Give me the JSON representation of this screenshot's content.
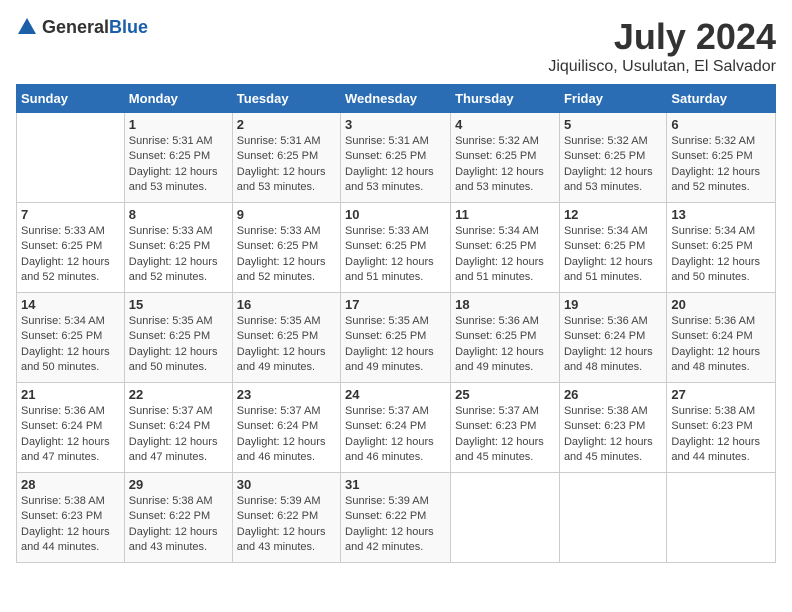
{
  "header": {
    "logo_general": "General",
    "logo_blue": "Blue",
    "title": "July 2024",
    "location": "Jiquilisco, Usulutan, El Salvador"
  },
  "weekdays": [
    "Sunday",
    "Monday",
    "Tuesday",
    "Wednesday",
    "Thursday",
    "Friday",
    "Saturday"
  ],
  "weeks": [
    [
      {
        "day": "",
        "info": ""
      },
      {
        "day": "1",
        "info": "Sunrise: 5:31 AM\nSunset: 6:25 PM\nDaylight: 12 hours\nand 53 minutes."
      },
      {
        "day": "2",
        "info": "Sunrise: 5:31 AM\nSunset: 6:25 PM\nDaylight: 12 hours\nand 53 minutes."
      },
      {
        "day": "3",
        "info": "Sunrise: 5:31 AM\nSunset: 6:25 PM\nDaylight: 12 hours\nand 53 minutes."
      },
      {
        "day": "4",
        "info": "Sunrise: 5:32 AM\nSunset: 6:25 PM\nDaylight: 12 hours\nand 53 minutes."
      },
      {
        "day": "5",
        "info": "Sunrise: 5:32 AM\nSunset: 6:25 PM\nDaylight: 12 hours\nand 53 minutes."
      },
      {
        "day": "6",
        "info": "Sunrise: 5:32 AM\nSunset: 6:25 PM\nDaylight: 12 hours\nand 52 minutes."
      }
    ],
    [
      {
        "day": "7",
        "info": "Sunrise: 5:33 AM\nSunset: 6:25 PM\nDaylight: 12 hours\nand 52 minutes."
      },
      {
        "day": "8",
        "info": "Sunrise: 5:33 AM\nSunset: 6:25 PM\nDaylight: 12 hours\nand 52 minutes."
      },
      {
        "day": "9",
        "info": "Sunrise: 5:33 AM\nSunset: 6:25 PM\nDaylight: 12 hours\nand 52 minutes."
      },
      {
        "day": "10",
        "info": "Sunrise: 5:33 AM\nSunset: 6:25 PM\nDaylight: 12 hours\nand 51 minutes."
      },
      {
        "day": "11",
        "info": "Sunrise: 5:34 AM\nSunset: 6:25 PM\nDaylight: 12 hours\nand 51 minutes."
      },
      {
        "day": "12",
        "info": "Sunrise: 5:34 AM\nSunset: 6:25 PM\nDaylight: 12 hours\nand 51 minutes."
      },
      {
        "day": "13",
        "info": "Sunrise: 5:34 AM\nSunset: 6:25 PM\nDaylight: 12 hours\nand 50 minutes."
      }
    ],
    [
      {
        "day": "14",
        "info": "Sunrise: 5:34 AM\nSunset: 6:25 PM\nDaylight: 12 hours\nand 50 minutes."
      },
      {
        "day": "15",
        "info": "Sunrise: 5:35 AM\nSunset: 6:25 PM\nDaylight: 12 hours\nand 50 minutes."
      },
      {
        "day": "16",
        "info": "Sunrise: 5:35 AM\nSunset: 6:25 PM\nDaylight: 12 hours\nand 49 minutes."
      },
      {
        "day": "17",
        "info": "Sunrise: 5:35 AM\nSunset: 6:25 PM\nDaylight: 12 hours\nand 49 minutes."
      },
      {
        "day": "18",
        "info": "Sunrise: 5:36 AM\nSunset: 6:25 PM\nDaylight: 12 hours\nand 49 minutes."
      },
      {
        "day": "19",
        "info": "Sunrise: 5:36 AM\nSunset: 6:24 PM\nDaylight: 12 hours\nand 48 minutes."
      },
      {
        "day": "20",
        "info": "Sunrise: 5:36 AM\nSunset: 6:24 PM\nDaylight: 12 hours\nand 48 minutes."
      }
    ],
    [
      {
        "day": "21",
        "info": "Sunrise: 5:36 AM\nSunset: 6:24 PM\nDaylight: 12 hours\nand 47 minutes."
      },
      {
        "day": "22",
        "info": "Sunrise: 5:37 AM\nSunset: 6:24 PM\nDaylight: 12 hours\nand 47 minutes."
      },
      {
        "day": "23",
        "info": "Sunrise: 5:37 AM\nSunset: 6:24 PM\nDaylight: 12 hours\nand 46 minutes."
      },
      {
        "day": "24",
        "info": "Sunrise: 5:37 AM\nSunset: 6:24 PM\nDaylight: 12 hours\nand 46 minutes."
      },
      {
        "day": "25",
        "info": "Sunrise: 5:37 AM\nSunset: 6:23 PM\nDaylight: 12 hours\nand 45 minutes."
      },
      {
        "day": "26",
        "info": "Sunrise: 5:38 AM\nSunset: 6:23 PM\nDaylight: 12 hours\nand 45 minutes."
      },
      {
        "day": "27",
        "info": "Sunrise: 5:38 AM\nSunset: 6:23 PM\nDaylight: 12 hours\nand 44 minutes."
      }
    ],
    [
      {
        "day": "28",
        "info": "Sunrise: 5:38 AM\nSunset: 6:23 PM\nDaylight: 12 hours\nand 44 minutes."
      },
      {
        "day": "29",
        "info": "Sunrise: 5:38 AM\nSunset: 6:22 PM\nDaylight: 12 hours\nand 43 minutes."
      },
      {
        "day": "30",
        "info": "Sunrise: 5:39 AM\nSunset: 6:22 PM\nDaylight: 12 hours\nand 43 minutes."
      },
      {
        "day": "31",
        "info": "Sunrise: 5:39 AM\nSunset: 6:22 PM\nDaylight: 12 hours\nand 42 minutes."
      },
      {
        "day": "",
        "info": ""
      },
      {
        "day": "",
        "info": ""
      },
      {
        "day": "",
        "info": ""
      }
    ]
  ]
}
